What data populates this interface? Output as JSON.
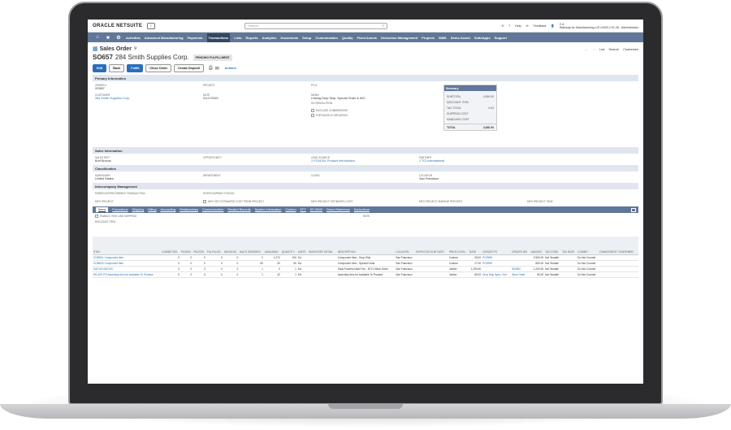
{
  "topbar": {
    "logo": "ORACLE NETSUITE",
    "search_placeholder": "Search",
    "help": "Help",
    "feedback": "Feedback",
    "user_initials": "C A",
    "user_account": "Stairway for Manufacturing LIS v2020.2.01.28 - Administrator"
  },
  "nav": {
    "items": [
      "Activities",
      "Advanced Manufacturing",
      "Payments",
      "Transactions",
      "Lists",
      "Reports",
      "Analytics",
      "Documents",
      "Setup",
      "Customization",
      "Quality",
      "Fixed Assets",
      "Deduction Management",
      "Projects",
      "WMS",
      "Demo Assist",
      "SuiteApps",
      "Support"
    ],
    "active": "Transactions"
  },
  "page": {
    "title": "Sales Order",
    "record_number": "SO657",
    "customer_name": "284 Smith Supplies Corp.",
    "status": "PENDING FULFILLMENT",
    "tools": [
      "List",
      "Search",
      "Customize"
    ]
  },
  "buttons": {
    "edit": "Edit",
    "back": "Back",
    "fulfill": "Fulfill",
    "close_order": "Close Order",
    "create_deposit": "Create Deposit",
    "actions": "Actions"
  },
  "primary": {
    "header": "Primary Information",
    "order_label": "ORDER #",
    "order_value": "SO657",
    "project_label": "PROJECT",
    "po_label": "PO #",
    "customer_label": "CUSTOMER",
    "customer_value": "284 Smith Supplies Corp.",
    "date_label": "DATE",
    "date_value": "01/17/2021",
    "memo_label": "MEMO",
    "memo_value": "Linking Drop Ship, Special Order & WO",
    "so_resolution": "SO RESOLUTION",
    "exclude_commissions": "EXCLUDE COMMISSIONS",
    "for_invoice_grouping": "FOR INVOICE GROUPING"
  },
  "summary": {
    "header": "Summary",
    "rows": [
      {
        "label": "SUBTOTAL",
        "value": "4,630.00"
      },
      {
        "label": "DISCOUNT ITEM",
        "value": ""
      },
      {
        "label": "TAX TOTAL",
        "value": "0.00"
      },
      {
        "label": "SHIPPING COST",
        "value": ""
      },
      {
        "label": "HANDLING COST",
        "value": ""
      }
    ],
    "total_label": "TOTAL",
    "total_value": "4,630.00"
  },
  "sales": {
    "header": "Sales Information",
    "sales_rep_label": "SALES REP",
    "sales_rep_value": "Burt Brocus",
    "opportunity_label": "OPPORTUNITY",
    "lead_source_label": "LEAD SOURCE",
    "lead_source_value": "1 PC6100L Product Introduction",
    "partner_label": "PARTNER",
    "partner_value": "1 TCI International"
  },
  "classification": {
    "header": "Classification",
    "subsidiary_label": "SUBSIDIARY",
    "subsidiary_value": "United States",
    "department_label": "DEPARTMENT",
    "class_label": "CLASS",
    "location_label": "LOCATION",
    "location_value": "San Francisco"
  },
  "intercompany": {
    "header": "Intercompany Management",
    "paired_label": "PAIRED INTERCOMPANY TRANSACTION",
    "status_label": "INTERCOMPANY STATUS",
    "mfg_project": "MFG PROJECT",
    "mfg_get_cost": "MFG GET ESTIMATED COST FROM PROJECT",
    "mfg_est_cost": "MFG PROJECT ESTIMATED COST",
    "mfg_markup": "MFG PROJECT MARKUP PERCENT",
    "mfg_task": "MFG PROJECT TASK"
  },
  "subtabs": [
    "Items",
    "Promotions",
    "Shipping",
    "Billing",
    "Accounting",
    "Relationships",
    "Communication",
    "Related Records",
    "System Information",
    "Custom",
    "EFT",
    "SS WMS",
    "Demo Reference",
    "Deductions"
  ],
  "items_area": {
    "enable_line_shipping": "ENABLE ITEM LINE SHIPPING",
    "rate": "RATE",
    "discount_item": "DISCOUNT ITEM"
  },
  "table": {
    "headers": [
      "ITEM",
      "COMMITTED",
      "PICKED",
      "PACKED",
      "FULFILLED",
      "INVOICED",
      "BACK ORDERED",
      "AVAILABLE",
      "QUANTITY",
      "UNITS",
      "INVENTORY DETAIL",
      "DESCRIPTION",
      "LOCATION",
      "EXPECTED SHIP DATE",
      "PRICE LEVEL",
      "RATE",
      "CREATE PO",
      "CREATE WO",
      "AMOUNT",
      "TAX CODE",
      "TAX RATE",
      "COMMIT",
      "COMMITMENT CONFIRMED"
    ],
    "rows": [
      [
        "COM001 Component Item",
        "0",
        "0",
        "0",
        "0",
        "0",
        "0",
        "1,272",
        "100",
        "Ea",
        "",
        "Component Item - Drop Ship",
        "San Francisco",
        "",
        "Custom",
        "25.00",
        "PO2998",
        "",
        "2,500.00",
        "Not Taxable",
        "",
        "Do Not Commit",
        ""
      ],
      [
        "COM002 Component Item",
        "0",
        "0",
        "0",
        "0",
        "0",
        "50",
        "30",
        "50",
        "Ea",
        "",
        "Component Item - Special Order",
        "San Francisco",
        "",
        "Custom",
        "17.00",
        "PO2999",
        "",
        "850.00",
        "Not Taxable",
        "",
        "Do Not Commit",
        ""
      ],
      [
        "SAF100 SAF100",
        "0",
        "0",
        "0",
        "0",
        "0",
        "1",
        "0",
        "1",
        "Ea",
        "",
        "Solar Powered Attic Fan - NT12 Work Order",
        "San Francisco",
        "",
        "Jobber",
        "1,200.00",
        "",
        "WO692",
        "1,200.00",
        "Not Taxable",
        "",
        "Do Not Commit",
        ""
      ],
      [
        "NS-ATP-FG Assembly Item for Available To Promise",
        "0",
        "0",
        "0",
        "0",
        "0",
        "1",
        "42",
        "1",
        "EA",
        "",
        "Assembly item for Available To Promise",
        "San Francisco",
        "",
        "Jobber",
        "80.00",
        "Drop Ship Spec. Ord.",
        "Work Order",
        "80.00",
        "Not Taxable",
        "",
        "Do Not Commit",
        ""
      ]
    ]
  }
}
